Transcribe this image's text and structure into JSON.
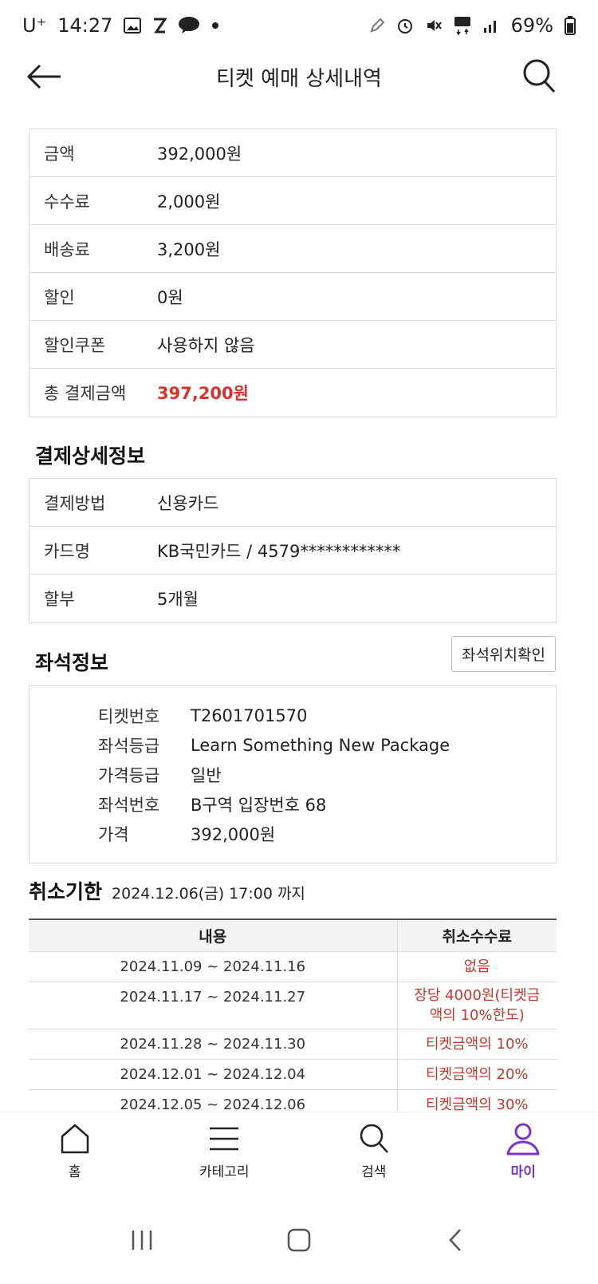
{
  "status_bar": {
    "carrier": "U⁺",
    "time": "14:27",
    "battery": "69%"
  },
  "header": {
    "title": "티켓 예매 상세내역"
  },
  "payment": {
    "rows": [
      {
        "label": "금액",
        "value": "392,000원"
      },
      {
        "label": "수수료",
        "value": "2,000원"
      },
      {
        "label": "배송료",
        "value": "3,200원"
      },
      {
        "label": "할인",
        "value": "0원"
      },
      {
        "label": "할인쿠폰",
        "value": "사용하지 않음"
      },
      {
        "label": "총 결제금액",
        "value": "397,200원"
      }
    ]
  },
  "payment_detail": {
    "title": "결제상세정보",
    "rows": [
      {
        "label": "결제방법",
        "value": "신용카드"
      },
      {
        "label": "카드명",
        "value": "KB국민카드 / 4579************"
      },
      {
        "label": "할부",
        "value": "5개월"
      }
    ]
  },
  "seat": {
    "title": "좌석정보",
    "location_button": "좌석위치확인",
    "rows": [
      {
        "label": "티켓번호",
        "value": "T2601701570"
      },
      {
        "label": "좌석등급",
        "value": "Learn Something New Package"
      },
      {
        "label": "가격등급",
        "value": "일반"
      },
      {
        "label": "좌석번호",
        "value": "B구역 입장번호 68"
      },
      {
        "label": "가격",
        "value": "392,000원"
      }
    ]
  },
  "cancel": {
    "title": "취소기한",
    "deadline": "2024.12.06(금) 17:00 까지",
    "headers": [
      "내용",
      "취소수수료"
    ],
    "rows": [
      {
        "period": "2024.11.09 ~ 2024.11.16",
        "fee": "없음"
      },
      {
        "period": "2024.11.17 ~ 2024.11.27",
        "fee": "장당 4000원(티켓금액의 10%한도)"
      },
      {
        "period": "2024.11.28 ~ 2024.11.30",
        "fee": "티켓금액의 10%"
      },
      {
        "period": "2024.12.01 ~ 2024.12.04",
        "fee": "티켓금액의 20%"
      },
      {
        "period": "2024.12.05 ~ 2024.12.06",
        "fee": "티켓금액의 30%"
      }
    ]
  },
  "bottom_nav": {
    "items": [
      {
        "label": "홈",
        "icon": "home-icon"
      },
      {
        "label": "카테고리",
        "icon": "menu-icon"
      },
      {
        "label": "검색",
        "icon": "search-icon"
      },
      {
        "label": "마이",
        "icon": "user-icon"
      }
    ],
    "active_color": "#7b35c9"
  },
  "colors": {
    "total_amount": "#d9342b",
    "cancel_fee": "#c0392b"
  }
}
